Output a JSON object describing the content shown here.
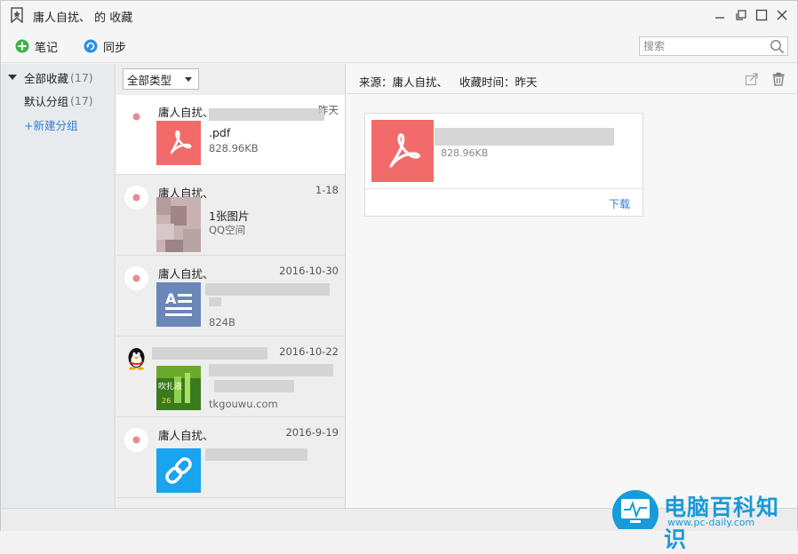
{
  "window": {
    "title": "庸人自扰、 的 收藏"
  },
  "toolbar": {
    "note_label": "笔记",
    "sync_label": "同步",
    "search_placeholder": "搜索"
  },
  "sidebar": {
    "all": {
      "label": "全部收藏",
      "count": "(17)"
    },
    "default": {
      "label": "默认分组",
      "count": "(17)"
    },
    "new_group": "+新建分组"
  },
  "list": {
    "filter_label": "全部类型",
    "items": [
      {
        "sender": "庸人自扰、",
        "date": "昨天",
        "line1": ".pdf",
        "line2": "828.96KB",
        "thumb": "pdf-icon"
      },
      {
        "sender": "庸人自扰、",
        "date": "1-18",
        "line1": "1张图片",
        "line2": "QQ空间",
        "thumb": "photo"
      },
      {
        "sender": "庸人自扰、",
        "date": "2016-10-30",
        "line1": "",
        "line2": "824B",
        "thumb": "document-icon"
      },
      {
        "sender": "",
        "date": "2016-10-22",
        "line1": "",
        "line2": "tkgouwu.com",
        "thumb": "web-image"
      },
      {
        "sender": "庸人自扰、",
        "date": "2016-9-19",
        "line1": "",
        "line2": "",
        "thumb": "link-icon"
      }
    ]
  },
  "detail": {
    "source": "来源：庸人自扰、",
    "time": "收藏时间：昨天",
    "file_size": "828.96KB",
    "download_label": "下载"
  },
  "watermark": {
    "name": "电脑百科知识",
    "url": "www.pc-daily.com"
  },
  "colors": {
    "pdf_red": "#f26b6b",
    "doc_blue": "#6b86b8",
    "link_blue": "#1aa3ef",
    "accent_blue": "#2f7ed8",
    "green": "#3ab54a"
  }
}
